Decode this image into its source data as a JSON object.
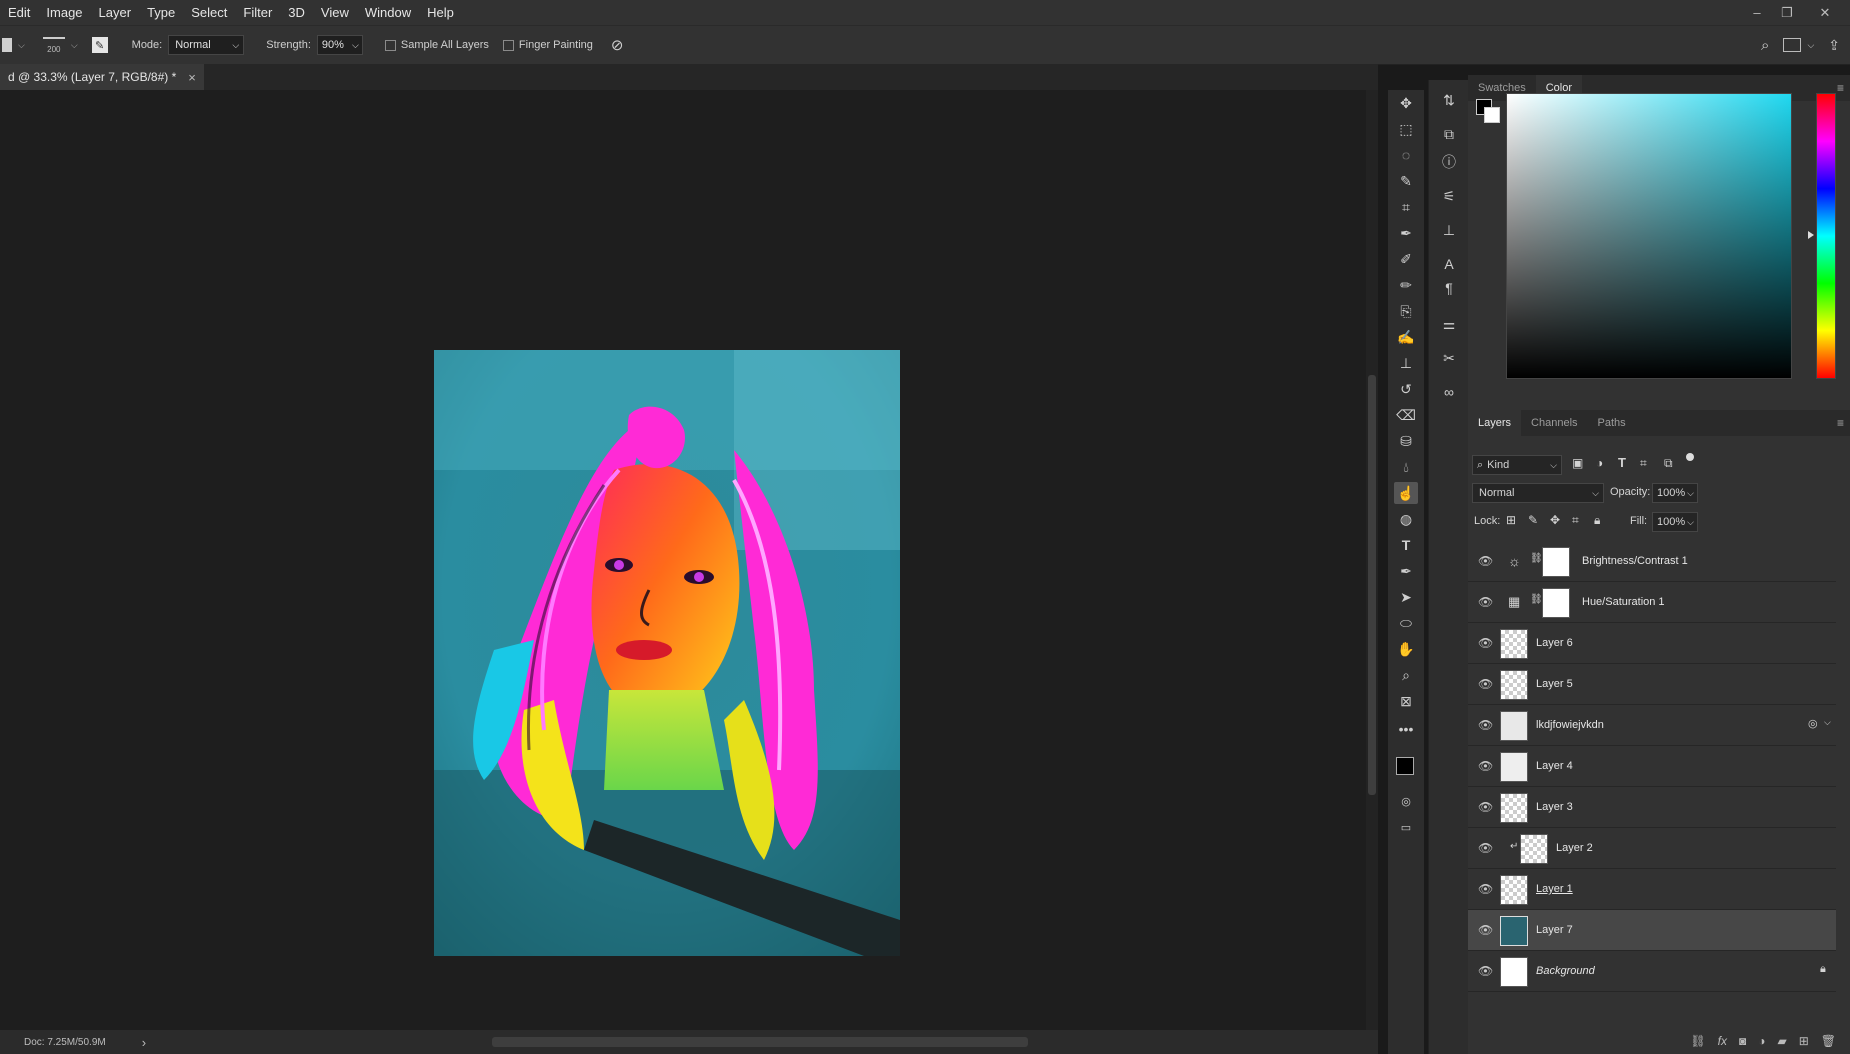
{
  "menubar": {
    "items": [
      "Edit",
      "Image",
      "Layer",
      "Type",
      "Select",
      "Filter",
      "3D",
      "View",
      "Window",
      "Help"
    ]
  },
  "options": {
    "brush_size": "200",
    "mode_label": "Mode:",
    "mode_value": "Normal",
    "strength_label": "Strength:",
    "strength_value": "90%",
    "sample_all_layers": "Sample All Layers",
    "finger_painting": "Finger Painting"
  },
  "document": {
    "tab_title": "d @ 33.3% (Layer 7, RGB/8#) *",
    "close": "×"
  },
  "status": {
    "doc_info": "Doc: 7.25M/50.9M",
    "arrow": "›"
  },
  "color_panel": {
    "tabs": [
      "Swatches",
      "Color"
    ],
    "active_tab": "Color",
    "hue_color": "#20d8f0"
  },
  "layers_panel": {
    "tabs": [
      "Layers",
      "Channels",
      "Paths"
    ],
    "active_tab": "Layers",
    "filter_kind": "Kind",
    "blend_mode": "Normal",
    "opacity_label": "Opacity:",
    "opacity_value": "100%",
    "lock_label": "Lock:",
    "fill_label": "Fill:",
    "fill_value": "100%",
    "layers": [
      {
        "name": "Brightness/Contrast 1",
        "kind": "adjustment"
      },
      {
        "name": "Hue/Saturation 1",
        "kind": "adjustment"
      },
      {
        "name": "Layer 6",
        "kind": "pixel"
      },
      {
        "name": "Layer 5",
        "kind": "pixel"
      },
      {
        "name": "lkdjfowiejvkdn",
        "kind": "smart"
      },
      {
        "name": "Layer 4",
        "kind": "pixel"
      },
      {
        "name": "Layer 3",
        "kind": "pixel"
      },
      {
        "name": "Layer 2",
        "kind": "clipped"
      },
      {
        "name": "Layer 1",
        "kind": "pixel"
      },
      {
        "name": "Layer 7",
        "kind": "pixel",
        "selected": true
      },
      {
        "name": "Background",
        "kind": "background",
        "locked": true
      }
    ]
  }
}
